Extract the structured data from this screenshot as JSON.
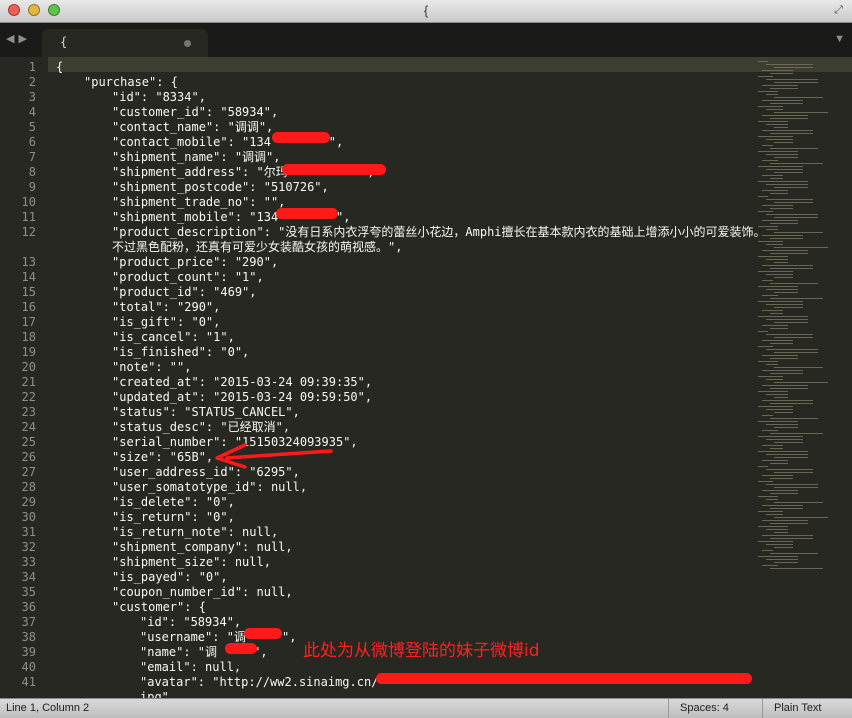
{
  "window": {
    "title": "{"
  },
  "tab": {
    "title": "{"
  },
  "status": {
    "position": "Line 1, Column 2",
    "spaces": "Spaces: 4",
    "syntax": "Plain Text"
  },
  "annotation": "此处为从微博登陆的妹子微博id",
  "lines": [
    {
      "n": "1",
      "i": 0,
      "t": "{"
    },
    {
      "n": "2",
      "i": 1,
      "t": "\"purchase\": {"
    },
    {
      "n": "3",
      "i": 2,
      "t": "\"id\": \"8334\","
    },
    {
      "n": "4",
      "i": 2,
      "t": "\"customer_id\": \"58934\","
    },
    {
      "n": "5",
      "i": 2,
      "t": "\"contact_name\": \"调调\","
    },
    {
      "n": "6",
      "i": 2,
      "t": "\"contact_mobile\": \"134        \","
    },
    {
      "n": "7",
      "i": 2,
      "t": "\"shipment_name\": \"调调\","
    },
    {
      "n": "8",
      "i": 2,
      "t": "\"shipment_address\": \"尔玛          \","
    },
    {
      "n": "9",
      "i": 2,
      "t": "\"shipment_postcode\": \"510726\","
    },
    {
      "n": "10",
      "i": 2,
      "t": "\"shipment_trade_no\": \"\","
    },
    {
      "n": "11",
      "i": 2,
      "t": "\"shipment_mobile\": \"134        \","
    },
    {
      "n": "12",
      "i": 2,
      "t": "\"product_description\": \"没有日系内衣浮夸的蕾丝小花边，Amphi擅长在基本款内衣的基础上增添小小的可爱装饰。"
    },
    {
      "n": "",
      "i": 2,
      "t": "不过黑色配粉，还真有可爱少女装酷女孩的萌视感。\","
    },
    {
      "n": "13",
      "i": 2,
      "t": "\"product_price\": \"290\","
    },
    {
      "n": "14",
      "i": 2,
      "t": "\"product_count\": \"1\","
    },
    {
      "n": "15",
      "i": 2,
      "t": "\"product_id\": \"469\","
    },
    {
      "n": "16",
      "i": 2,
      "t": "\"total\": \"290\","
    },
    {
      "n": "17",
      "i": 2,
      "t": "\"is_gift\": \"0\","
    },
    {
      "n": "18",
      "i": 2,
      "t": "\"is_cancel\": \"1\","
    },
    {
      "n": "19",
      "i": 2,
      "t": "\"is_finished\": \"0\","
    },
    {
      "n": "20",
      "i": 2,
      "t": "\"note\": \"\","
    },
    {
      "n": "21",
      "i": 2,
      "t": "\"created_at\": \"2015-03-24 09:39:35\","
    },
    {
      "n": "22",
      "i": 2,
      "t": "\"updated_at\": \"2015-03-24 09:59:50\","
    },
    {
      "n": "23",
      "i": 2,
      "t": "\"status\": \"STATUS_CANCEL\","
    },
    {
      "n": "24",
      "i": 2,
      "t": "\"status_desc\": \"已经取消\","
    },
    {
      "n": "25",
      "i": 2,
      "t": "\"serial_number\": \"15150324093935\","
    },
    {
      "n": "26",
      "i": 2,
      "t": "\"size\": \"65B\","
    },
    {
      "n": "27",
      "i": 2,
      "t": "\"user_address_id\": \"6295\","
    },
    {
      "n": "28",
      "i": 2,
      "t": "\"user_somatotype_id\": null,"
    },
    {
      "n": "29",
      "i": 2,
      "t": "\"is_delete\": \"0\","
    },
    {
      "n": "30",
      "i": 2,
      "t": "\"is_return\": \"0\","
    },
    {
      "n": "31",
      "i": 2,
      "t": "\"is_return_note\": null,"
    },
    {
      "n": "32",
      "i": 2,
      "t": "\"shipment_company\": null,"
    },
    {
      "n": "33",
      "i": 2,
      "t": "\"shipment_size\": null,"
    },
    {
      "n": "34",
      "i": 2,
      "t": "\"is_payed\": \"0\","
    },
    {
      "n": "35",
      "i": 2,
      "t": "\"coupon_number_id\": null,"
    },
    {
      "n": "36",
      "i": 2,
      "t": "\"customer\": {"
    },
    {
      "n": "37",
      "i": 3,
      "t": "\"id\": \"58934\","
    },
    {
      "n": "38",
      "i": 3,
      "t": "\"username\": \"调     \","
    },
    {
      "n": "39",
      "i": 3,
      "t": "\"name\": \"调     \","
    },
    {
      "n": "40",
      "i": 3,
      "t": "\"email\": null,"
    },
    {
      "n": "41",
      "i": 3,
      "t": "\"avatar\": \"http://ww2.sinaimg.cn/"
    },
    {
      "n": "",
      "i": 3,
      "t": "ipg\","
    }
  ],
  "colors": {
    "background": "#272822",
    "text": "#f8f8f2",
    "gutter_text": "#8f908a",
    "current_line": "#3e3d32",
    "markup": "#ff1a1a"
  }
}
